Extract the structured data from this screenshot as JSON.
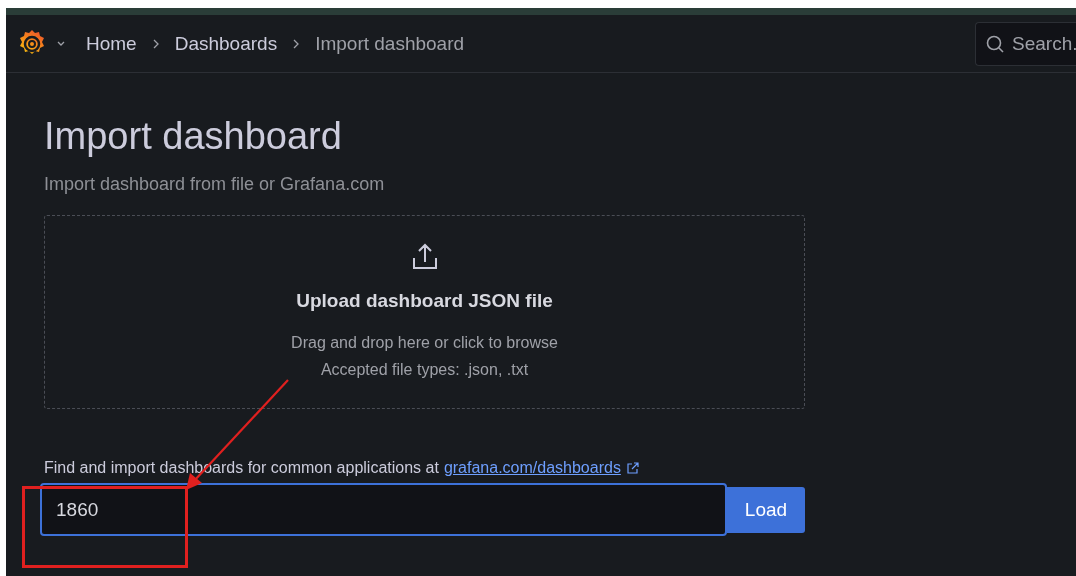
{
  "breadcrumbs": [
    {
      "label": "Home",
      "current": false
    },
    {
      "label": "Dashboards",
      "current": false
    },
    {
      "label": "Import dashboard",
      "current": true
    }
  ],
  "search": {
    "placeholder": "Search."
  },
  "page": {
    "title": "Import dashboard",
    "subtitle": "Import dashboard from file or Grafana.com"
  },
  "upload": {
    "title": "Upload dashboard JSON file",
    "hint": "Drag and drop here or click to browse",
    "types": "Accepted file types: .json, .txt"
  },
  "gcom": {
    "label": "Find and import dashboards for common applications at",
    "link": "grafana.com/dashboards",
    "value": "1860",
    "button": "Load"
  }
}
